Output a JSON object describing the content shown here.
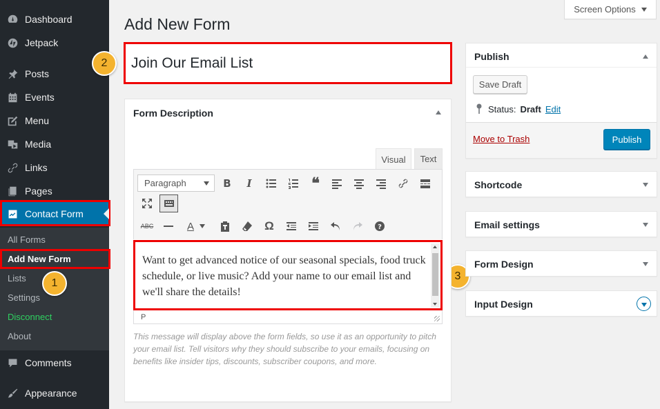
{
  "sidebar": {
    "menu": [
      {
        "label": "Dashboard",
        "icon": "dashboard-icon"
      },
      {
        "label": "Jetpack",
        "icon": "jetpack-icon"
      },
      {
        "label": "Posts",
        "icon": "pin-icon"
      },
      {
        "label": "Events",
        "icon": "calendar-icon"
      },
      {
        "label": "Menu",
        "icon": "edit-icon"
      },
      {
        "label": "Media",
        "icon": "media-icon"
      },
      {
        "label": "Links",
        "icon": "link-icon"
      },
      {
        "label": "Pages",
        "icon": "pages-icon"
      },
      {
        "label": "Contact Form",
        "icon": "contact-form-icon",
        "active": true
      },
      {
        "label": "Comments",
        "icon": "comment-icon"
      },
      {
        "label": "Appearance",
        "icon": "brush-icon"
      }
    ],
    "submenu": [
      {
        "label": "All Forms"
      },
      {
        "label": "Add New Form",
        "current": true
      },
      {
        "label": "Lists"
      },
      {
        "label": "Settings"
      },
      {
        "label": "Disconnect",
        "color": "#2fd160"
      },
      {
        "label": "About"
      }
    ]
  },
  "badges": [
    "1",
    "2",
    "3"
  ],
  "header": {
    "title": "Add New Form",
    "screen_options": "Screen Options"
  },
  "form": {
    "title_value": "Join Our Email List",
    "description_box_title": "Form Description",
    "tabs": [
      "Visual",
      "Text"
    ],
    "format_select": "Paragraph",
    "editor_text": "Want to get advanced notice of our seasonal specials, food truck schedule, or live music? Add your name to our email list and we'll share the details!",
    "path_indicator": "P",
    "help_text": "This message will display above the form fields, so use it as an opportunity to pitch your email list. Tell visitors why they should subscribe to your emails, focusing on benefits like insider tips, discounts, subscriber coupons, and more."
  },
  "publish": {
    "title": "Publish",
    "save_draft": "Save Draft",
    "status_label": "Status:",
    "status_value": "Draft",
    "edit_link": "Edit",
    "trash_link": "Move to Trash",
    "publish_button": "Publish"
  },
  "side_boxes": [
    "Shortcode",
    "Email settings",
    "Form Design",
    "Input Design"
  ],
  "colors": {
    "sidebar_bg": "#23282d",
    "active_bg": "#0073aa",
    "highlight": "#ee0000",
    "badge": "#f4b32f",
    "primary_button": "#0085ba"
  }
}
